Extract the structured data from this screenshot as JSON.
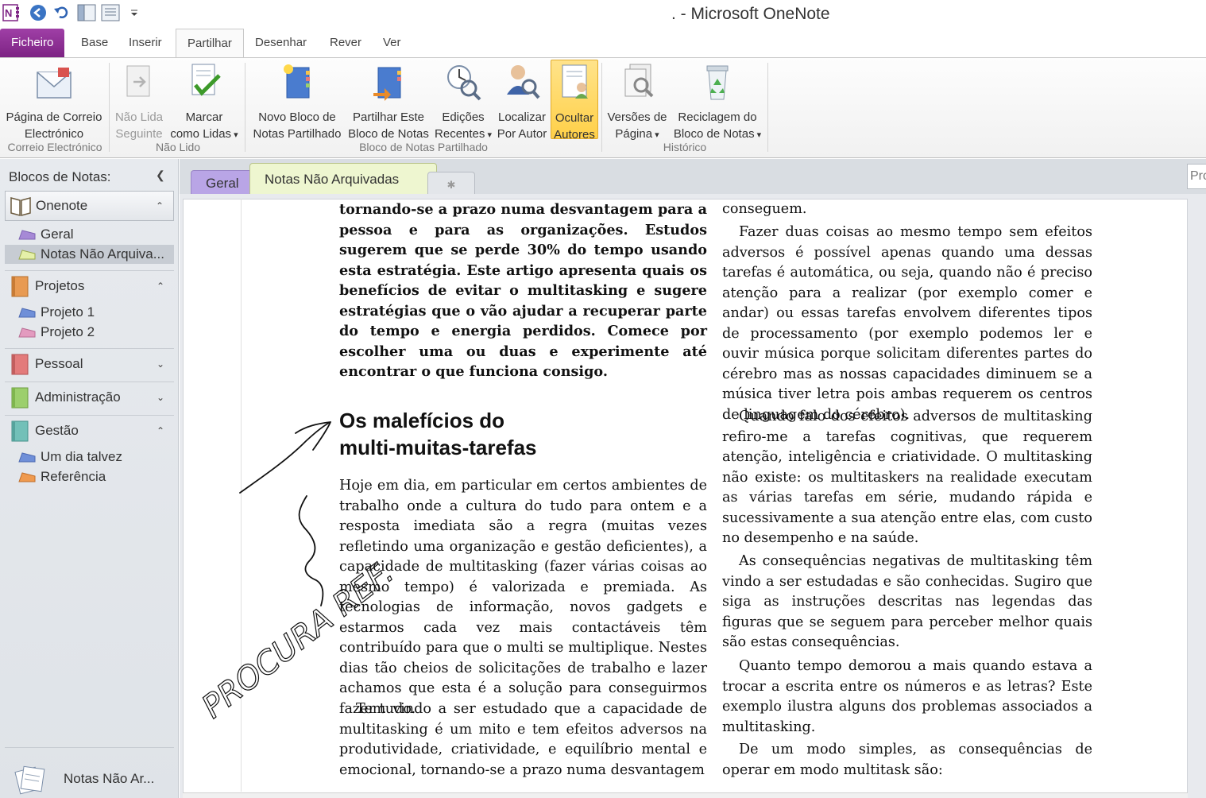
{
  "window": {
    "title": ". - Microsoft OneNote"
  },
  "quick_access": [
    {
      "name": "onenote-logo-icon"
    },
    {
      "name": "back-icon"
    },
    {
      "name": "undo-icon"
    },
    {
      "name": "dock-view-icon"
    },
    {
      "name": "full-page-view-icon"
    },
    {
      "name": "customize-qat-icon"
    }
  ],
  "ribbon_tabs": [
    "Ficheiro",
    "Base",
    "Inserir",
    "Partilhar",
    "Desenhar",
    "Rever",
    "Ver"
  ],
  "ribbon": {
    "email_page": [
      "Página de Correio",
      "Electrónico"
    ],
    "not_read_next": [
      "Não Lida",
      "Seguinte"
    ],
    "mark_as_read": [
      "Marcar",
      "como Lidas"
    ],
    "new_shared_notebook": [
      "Novo Bloco de",
      "Notas Partilhado"
    ],
    "share_notebook": [
      "Partilhar Este",
      "Bloco de Notas"
    ],
    "recent_edits": [
      "Edições",
      "Recentes"
    ],
    "find_by_author": [
      "Localizar",
      "Por Autor"
    ],
    "hide_authors": [
      "Ocultar",
      "Autores"
    ],
    "page_versions": [
      "Versões de",
      "Página"
    ],
    "notebook_recycle_bin": [
      "Reciclagem do",
      "Bloco de Notas"
    ],
    "groups": {
      "email": "Correio Electrónico",
      "unread": "Não Lido",
      "shared_notebook": "Bloco de Notas Partilhado",
      "history": "Histórico"
    }
  },
  "sidebar": {
    "header": "Blocos de Notas:",
    "notebooks": [
      {
        "label": "Onenote",
        "color": "#7a6a4f",
        "sections": [
          {
            "label": "Geral",
            "color": "#a689d6"
          },
          {
            "label": "Notas Não Arquiva...",
            "color": "#c9e07a"
          }
        ]
      },
      {
        "label": "Projetos",
        "color": "#e89a52",
        "sections": [
          {
            "label": "Projeto 1",
            "color": "#6f8fd8"
          },
          {
            "label": "Projeto 2",
            "color": "#e39bbf"
          }
        ]
      },
      {
        "label": "Pessoal",
        "color": "#e37b7b",
        "sections": []
      },
      {
        "label": "Administração",
        "color": "#9ccf6c",
        "sections": []
      },
      {
        "label": "Gestão",
        "color": "#72c0b8",
        "sections": [
          {
            "label": "Um dia talvez",
            "color": "#6f8fd8"
          },
          {
            "label": "Referência",
            "color": "#ef9a4f"
          }
        ]
      }
    ],
    "unfiled": "Notas Não Ar..."
  },
  "section_tabs": [
    {
      "label": "Geral",
      "color": "#b9a5e6"
    },
    {
      "label": "Notas Não Arquivadas",
      "color": "#eef6d0"
    }
  ],
  "search": {
    "placeholder": "Pro"
  },
  "article": {
    "intro_bold": "tornando-se a prazo numa desvantagem para a pessoa e para as organizações. Estudos sugerem que se perde 30% do tempo usando esta estratégia. Este artigo apresenta quais os benefícios de evitar o multitasking e sugere estratégias que o vão ajudar a recuperar parte do tempo e energia perdidos. Comece por escolher uma ou duas e experimente até encontrar o que funciona consigo.",
    "heading_line1": "Os malefícios do",
    "heading_line2": "multi-muitas-tarefas",
    "left_p1": "Hoje em dia, em particular em certos ambientes de trabalho onde a cultura do tudo para ontem e a resposta imediata são a regra (muitas vezes refletindo uma organização e gestão deficientes), a capacidade de multitasking (fazer várias coisas ao mesmo tempo) é valorizada e premiada. As tecnologias de informação, novos gadgets e estarmos cada vez mais contactáveis têm contribuído para que o multi se multiplique. Nestes dias tão cheios de solicitações de trabalho e lazer achamos que esta é a solução para conseguirmos fazer tudo.",
    "left_p2": "Tem vindo a ser estudado que a capacidade de multitasking é um mito e tem efeitos adversos na produtividade, criatividade, e equilíbrio mental e emocional, tornando-se a prazo numa desvantagem",
    "right_p0": "conseguem.",
    "right_p1": "Fazer duas coisas ao mesmo tempo sem efeitos adversos é possível apenas quando uma dessas tarefas é automática, ou seja, quando não é preciso atenção para a realizar (por exemplo comer e andar) ou essas tarefas envolvem diferentes tipos de processamento (por exemplo podemos ler e ouvir música porque solicitam diferentes partes do cérebro mas as nossas capacidades diminuem se a música tiver letra pois ambas requerem os centros de linguagem do cérebro).",
    "right_p2": "Quando falo dos efeitos adversos de multitasking refiro-me a tarefas cognitivas, que requerem atenção, inteligência e criatividade. O multitasking não existe: os multitaskers na realidade executam as várias tarefas em série, mudando rápida e sucessivamente a sua atenção entre elas, com custo no desempenho e na saúde.",
    "right_p3": "As consequências negativas de multitasking têm vindo a ser estudadas e são conhecidas. Sugiro que siga as instruções descritas nas legendas das figuras que se seguem para perceber melhor quais são estas consequências.",
    "right_p4": "Quanto tempo demorou a mais quando estava a trocar a escrita entre os números e as letras? Este exemplo ilustra alguns dos problemas associados a multitasking.",
    "right_p5": "De um modo simples, as consequências de operar em modo multitask são:"
  },
  "ink": {
    "handwriting": "PROCURA REF."
  },
  "colors": {
    "file_tab": "#8e2f95",
    "highlight": "#ffd048",
    "accent": "#4472c4"
  }
}
